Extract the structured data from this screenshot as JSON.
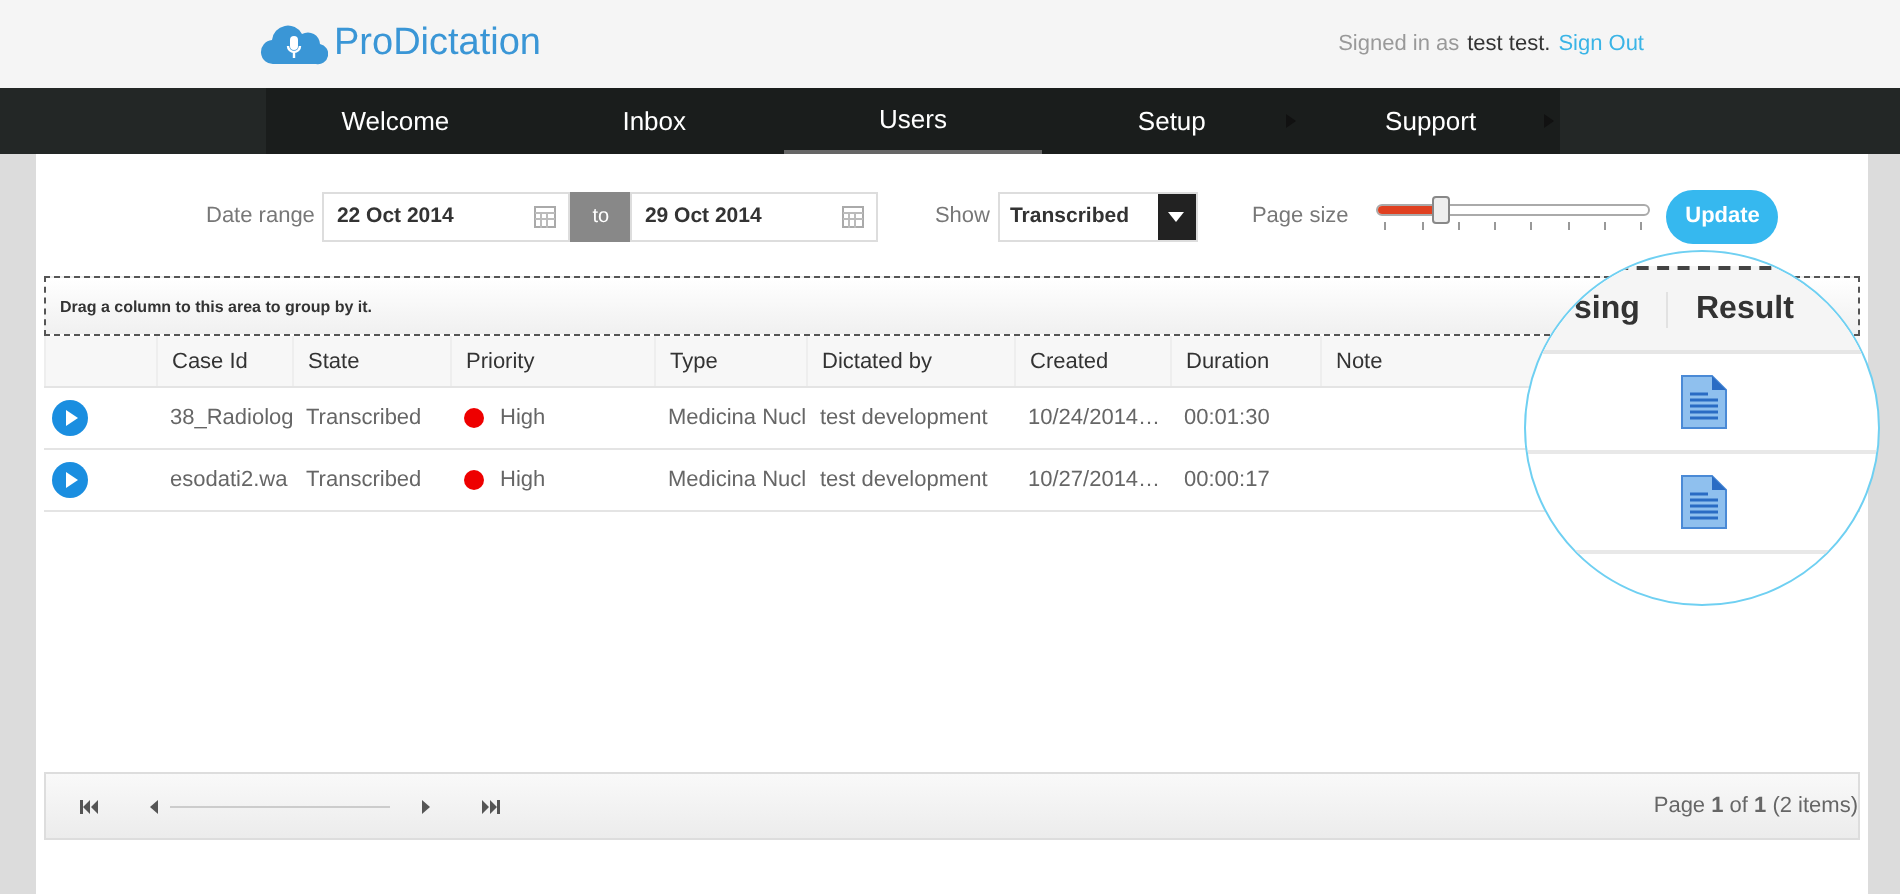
{
  "brand": {
    "name": "ProDictation"
  },
  "account": {
    "prefix": "Signed in as",
    "user": "test test.",
    "link": "Sign Out"
  },
  "nav": [
    {
      "label": "Welcome",
      "selected": false,
      "submenu": false
    },
    {
      "label": "Inbox",
      "selected": false,
      "submenu": false
    },
    {
      "label": "Users",
      "selected": true,
      "submenu": false
    },
    {
      "label": "Setup",
      "selected": false,
      "submenu": true
    },
    {
      "label": "Support",
      "selected": false,
      "submenu": true
    }
  ],
  "filters": {
    "date_range_label": "Date range",
    "from": "22 Oct 2014",
    "to_label": "to",
    "to": "29 Oct 2014",
    "show_label": "Show",
    "show_value": "Transcribed",
    "page_size_label": "Page size",
    "level": 0.22,
    "update": "Update"
  },
  "group_panel": "Drag a column to this area to group by it.",
  "table": {
    "columns": [
      "Case Id",
      "State",
      "Priority",
      "Type",
      "Dictated by",
      "Created",
      "Duration",
      "Note"
    ],
    "rows": [
      {
        "case_id": "38_Radiolog",
        "state": "Transcribed",
        "priority": "High",
        "color": "#ee0000",
        "type": "Medicina Nucl",
        "dictated_by": "test development",
        "created": "10/24/2014…",
        "duration": "00:01:30",
        "note": ""
      },
      {
        "case_id": "esodati2.wa",
        "state": "Transcribed",
        "priority": "High",
        "color": "#ee0000",
        "type": "Medicina Nucl",
        "dictated_by": "test development",
        "created": "10/27/2014…",
        "duration": "00:00:17",
        "note": ""
      }
    ]
  },
  "magnifier": {
    "columns": [
      "sing",
      "Result"
    ],
    "rows": [
      {
        "has_result": true
      },
      {
        "has_result": true
      }
    ]
  },
  "pager": {
    "summary": "Page **1** of **1** (2 items)"
  }
}
